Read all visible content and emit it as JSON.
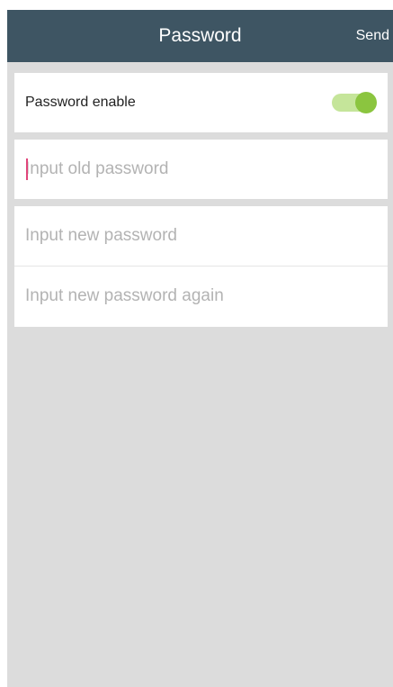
{
  "navbar": {
    "title": "Password",
    "send_label": "Send"
  },
  "settings": {
    "password_enable_label": "Password enable",
    "password_enable_on": true
  },
  "fields": {
    "old_password_placeholder": "Input old password",
    "new_password_placeholder": "Input new password",
    "new_password_again_placeholder": "Input new password again"
  },
  "colors": {
    "navbar_bg": "#3e5563",
    "toggle_on": "#8bc53f",
    "toggle_track": "#c5e59a",
    "caret": "#e0457a",
    "background": "#dcdcdc"
  }
}
